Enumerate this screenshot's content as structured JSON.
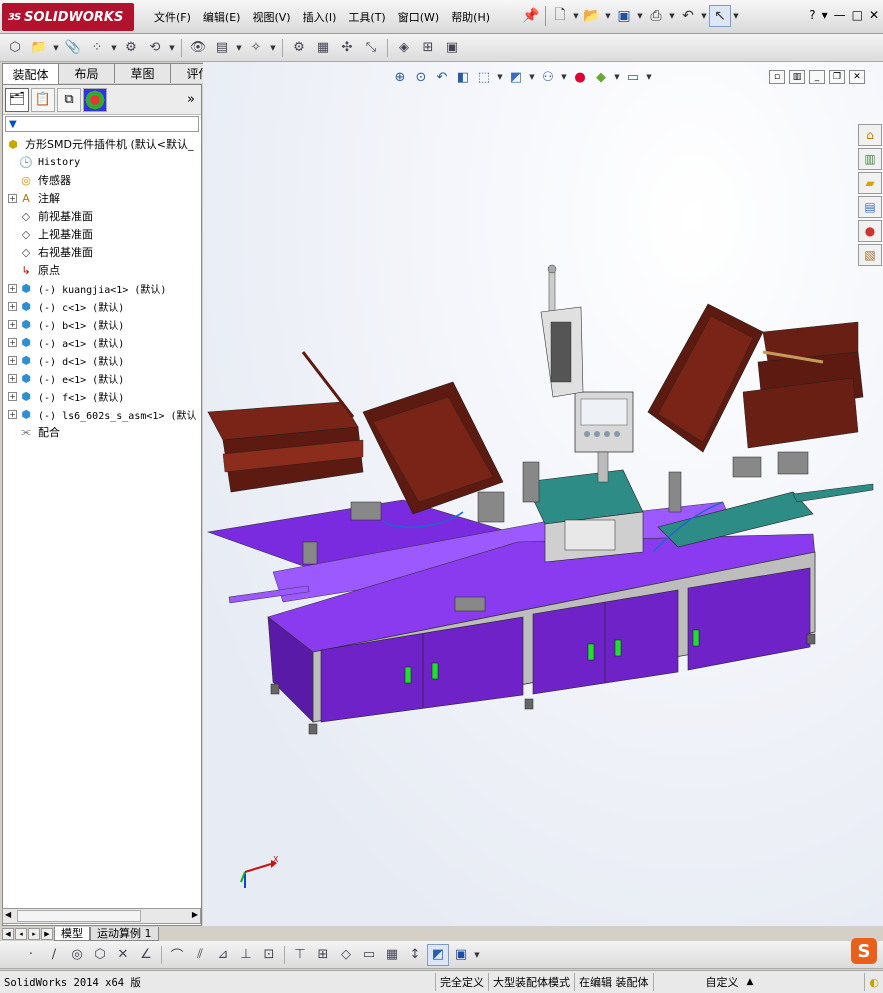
{
  "app": {
    "brand": "SOLIDWORKS",
    "brand_mark": "3S",
    "brand_color": "#b3122f"
  },
  "menu": [
    "文件(F)",
    "编辑(E)",
    "视图(V)",
    "插入(I)",
    "工具(T)",
    "窗口(W)",
    "帮助(H)"
  ],
  "window_controls": [
    "?",
    "▾",
    "—",
    "□",
    "✕"
  ],
  "command_tabs": [
    {
      "label": "装配体",
      "active": true
    },
    {
      "label": "布局",
      "active": false
    },
    {
      "label": "草图",
      "active": false
    },
    {
      "label": "评估",
      "active": false
    }
  ],
  "feature_tree": {
    "filter_icon": "filter-icon",
    "root": "方形SMD元件插件机  (默认<默认_",
    "items": [
      {
        "label": "History",
        "icon": "history-icon",
        "expandable": false,
        "mono": true
      },
      {
        "label": "传感器",
        "icon": "sensor-icon",
        "expandable": false
      },
      {
        "label": "注解",
        "icon": "annotation-icon",
        "expandable": true
      },
      {
        "label": "前视基准面",
        "icon": "plane-icon",
        "expandable": false
      },
      {
        "label": "上视基准面",
        "icon": "plane-icon",
        "expandable": false
      },
      {
        "label": "右视基准面",
        "icon": "plane-icon",
        "expandable": false
      },
      {
        "label": "原点",
        "icon": "origin-icon",
        "expandable": false
      },
      {
        "label": "(-) kuangjia<1> (默认)",
        "icon": "assembly-icon",
        "expandable": true,
        "mono": true
      },
      {
        "label": "(-) c<1> (默认)",
        "icon": "assembly-icon",
        "expandable": true,
        "mono": true
      },
      {
        "label": "(-) b<1> (默认)",
        "icon": "assembly-icon",
        "expandable": true,
        "mono": true
      },
      {
        "label": "(-) a<1> (默认)",
        "icon": "assembly-icon",
        "expandable": true,
        "mono": true
      },
      {
        "label": "(-) d<1> (默认)",
        "icon": "assembly-icon",
        "expandable": true,
        "mono": true
      },
      {
        "label": "(-) e<1> (默认)",
        "icon": "assembly-icon",
        "expandable": true,
        "mono": true
      },
      {
        "label": "(-) f<1> (默认)",
        "icon": "assembly-icon",
        "expandable": true,
        "mono": true
      },
      {
        "label": "(-) ls6_602s_s_asm<1> (默认",
        "icon": "assembly-icon",
        "expandable": true,
        "mono": true
      },
      {
        "label": "配合",
        "icon": "mates-icon",
        "expandable": false
      }
    ]
  },
  "bottom_tabs": [
    {
      "label": "模型",
      "active": true
    },
    {
      "label": "运动算例 1",
      "active": false
    }
  ],
  "status": {
    "app_version": "SolidWorks 2014 x64 版",
    "fully_defined": "完全定义",
    "mode": "大型装配体模式",
    "editing": "在编辑 装配体",
    "units": "自定义"
  },
  "triad": {
    "x_label": "X"
  },
  "colors": {
    "machine_purple": "#7a2be0",
    "cabinet_purple": "#6f22c8",
    "frame_gray": "#b9b9b9",
    "teal_deck": "#2e8c86",
    "tray_red": "#7a2418",
    "door_handle": "#22dd33"
  }
}
